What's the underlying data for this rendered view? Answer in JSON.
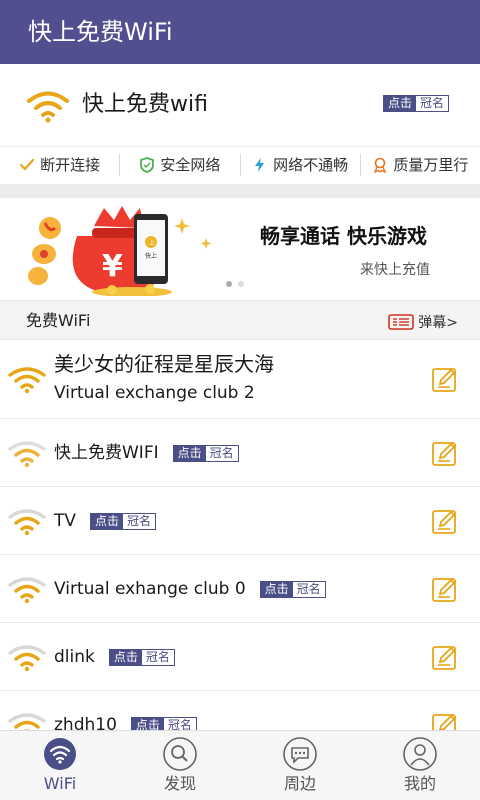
{
  "colors": {
    "title_bar": "#514f8f",
    "accent_gold": "#e8a617",
    "badge": "#4a4f87",
    "divider": "#ececec"
  },
  "header": {
    "title": "快上免费WiFi"
  },
  "connected": {
    "ssid": "快上免费wifi",
    "badge": {
      "click": "点击",
      "name": "冠名"
    },
    "actions": [
      {
        "label": "断开连接",
        "icon": "check-icon"
      },
      {
        "label": "安全网络",
        "icon": "shield-icon"
      },
      {
        "label": "网络不通畅",
        "icon": "lightning-icon"
      },
      {
        "label": "质量万里行",
        "icon": "medal-icon"
      }
    ]
  },
  "banner": {
    "headline": "畅享通话 快乐游戏",
    "sub": "来快上充值",
    "phone_brand": "快上",
    "slides": 2,
    "active_slide": 1
  },
  "section": {
    "title": "免费WiFi",
    "danmu_label": "弹幕>"
  },
  "networks": [
    {
      "name": "美少女的征程是星辰大海",
      "subtitle": "Virtual exchange club 2",
      "signal": 2
    },
    {
      "name": "快上免费WIFI",
      "badge": {
        "click": "点击",
        "name": "冠名"
      },
      "signal": 1
    },
    {
      "name": "TV",
      "badge": {
        "click": "点击",
        "name": "冠名"
      },
      "signal": 1
    },
    {
      "name": "Virtual exhange club 0",
      "badge": {
        "click": "点击",
        "name": "冠名"
      },
      "signal": 1
    },
    {
      "name": "dlink",
      "badge": {
        "click": "点击",
        "name": "冠名"
      },
      "signal": 1
    },
    {
      "name": "zhdh10",
      "badge": {
        "click": "点击",
        "name": "冠名"
      },
      "signal": 1
    }
  ],
  "bottom_nav": [
    {
      "label": "WiFi",
      "icon": "wifi-icon",
      "active": true
    },
    {
      "label": "发现",
      "icon": "search-icon",
      "active": false
    },
    {
      "label": "周边",
      "icon": "chat-icon",
      "active": false
    },
    {
      "label": "我的",
      "icon": "profile-icon",
      "active": false
    }
  ]
}
